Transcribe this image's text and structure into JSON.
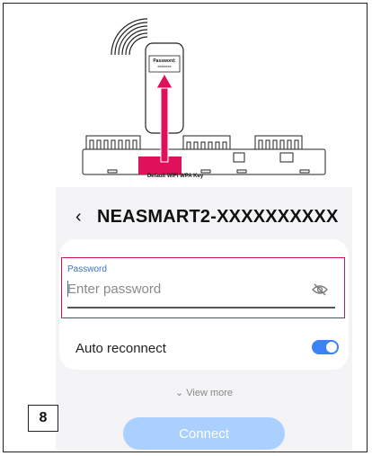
{
  "illustration": {
    "password_tag": "Password:",
    "password_mask": "********",
    "caption": "Default WIFI WPA Key",
    "highlight_color": "#e0105a",
    "icons": [
      "wifi-signal-icon",
      "arrow-up-icon"
    ]
  },
  "header": {
    "back_icon": "‹",
    "ssid": "NEASMART2-XXXXXXXXXX"
  },
  "password_field": {
    "label": "Password",
    "placeholder": "Enter password",
    "icon": "eye-off-icon",
    "border_color": "#c2185b"
  },
  "auto_reconnect": {
    "label": "Auto reconnect",
    "enabled": true,
    "accent": "#3b82f6"
  },
  "view_more": {
    "label": "View more",
    "icon": "⌄"
  },
  "connect_button": {
    "label": "Connect",
    "color": "#a9d0ff"
  },
  "step_badge": {
    "number": "8"
  }
}
